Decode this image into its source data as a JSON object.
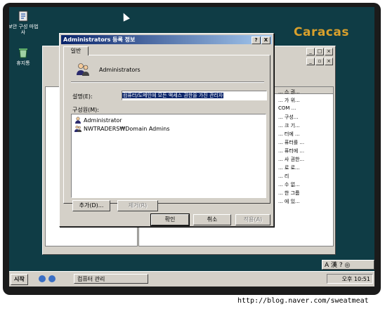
{
  "desktop": {
    "brand": "Caracas",
    "icons": [
      {
        "label": "보안 구성 마법사"
      },
      {
        "label": "휴지통"
      }
    ]
  },
  "background_window": {
    "right_pane_rows": [
      "... 스 권...",
      "... 가 위...",
      "COM ...",
      "... 구성...",
      "... 크 기...",
      "... 터에 ...",
      "... 퓨터를 ...",
      "... 퓨터에 ...",
      "... 사 권한...",
      "... 로 로...",
      "... 리",
      "... 수 없...",
      "... 한 그룹",
      "... 에 있..."
    ]
  },
  "dialog": {
    "title": "Administrators 등록 정보",
    "help_btn": "?",
    "close_btn": "X",
    "tab_general": "일반",
    "group_name": "Administrators",
    "description_label": "설명(E):",
    "description_value": "컴퓨터/도메인에 모든 액세스 권한을 가진 관리자",
    "members_label": "구성원(M):",
    "members": [
      {
        "name": "Administrator",
        "kind": "user"
      },
      {
        "name": "NWTRADERS₩Domain Admins",
        "kind": "group"
      }
    ],
    "add_button": "추가(D)...",
    "remove_button": "제거(R)",
    "ok_button": "확인",
    "cancel_button": "취소",
    "apply_button": "적용(A)"
  },
  "taskbar": {
    "start": "시작",
    "task": "컴퓨터 관리",
    "ime": "A 漢 ? ◎",
    "clock": "오후 10:51"
  },
  "watermark": "http://blog.naver.com/sweatmeat"
}
